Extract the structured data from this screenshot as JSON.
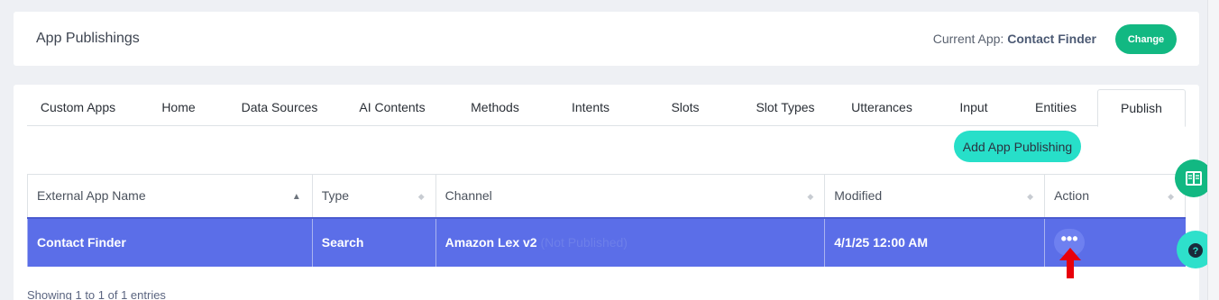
{
  "header": {
    "title": "App Publishings",
    "current_app_label": "Current App:",
    "current_app_name": "Contact Finder",
    "change_label": "Change"
  },
  "tabs": [
    {
      "label": "Custom Apps"
    },
    {
      "label": "Home"
    },
    {
      "label": "Data Sources"
    },
    {
      "label": "AI Contents"
    },
    {
      "label": "Methods"
    },
    {
      "label": "Intents"
    },
    {
      "label": "Slots"
    },
    {
      "label": "Slot Types"
    },
    {
      "label": "Utterances"
    },
    {
      "label": "Input"
    },
    {
      "label": "Entities"
    },
    {
      "label": "Publish"
    }
  ],
  "active_tab": "Publish",
  "add_button_label": "Add App Publishing",
  "table": {
    "columns": [
      "External App Name",
      "Type",
      "Channel",
      "Modified",
      "Action"
    ],
    "rows": [
      {
        "name": "Contact Finder",
        "type": "Search",
        "channel": "Amazon Lex v2",
        "channel_status": "(Not Published)",
        "modified": "4/1/25 12:00 AM",
        "action_label": "•••"
      }
    ]
  },
  "footer_info": "Showing 1 to 1 of 1 entries",
  "colors": {
    "primary_green": "#12b882",
    "teal": "#27dfc9",
    "selected_row": "#5b6ee8",
    "arrow": "#e8000b"
  },
  "icons": [
    "book-icon",
    "help-icon",
    "sort-asc-icon",
    "sort-icon",
    "more-icon",
    "red-arrow-icon"
  ]
}
